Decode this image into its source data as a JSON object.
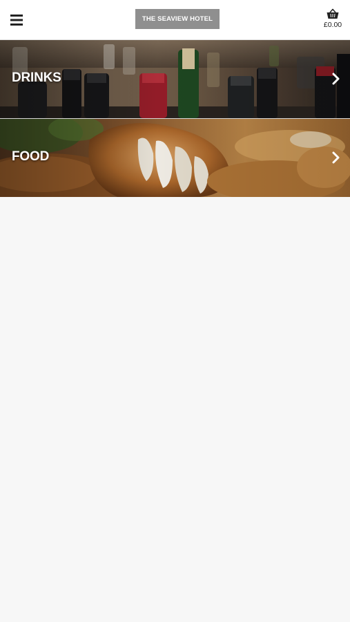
{
  "header": {
    "menu_icon": "hamburger-menu-icon",
    "logo_text": "THE SEAVIEW HOTEL",
    "logo_bg_color": "#8f8f8f",
    "basket_icon": "shopping-basket-icon",
    "basket_total": "£0.00"
  },
  "categories": [
    {
      "label": "DRINKS",
      "icon": "chevron-right-icon"
    },
    {
      "label": "FOOD",
      "icon": "chevron-right-icon"
    }
  ],
  "colors": {
    "header_bg": "#ffffff",
    "page_bg": "#f7f7f7",
    "label_text": "#ffffff"
  }
}
